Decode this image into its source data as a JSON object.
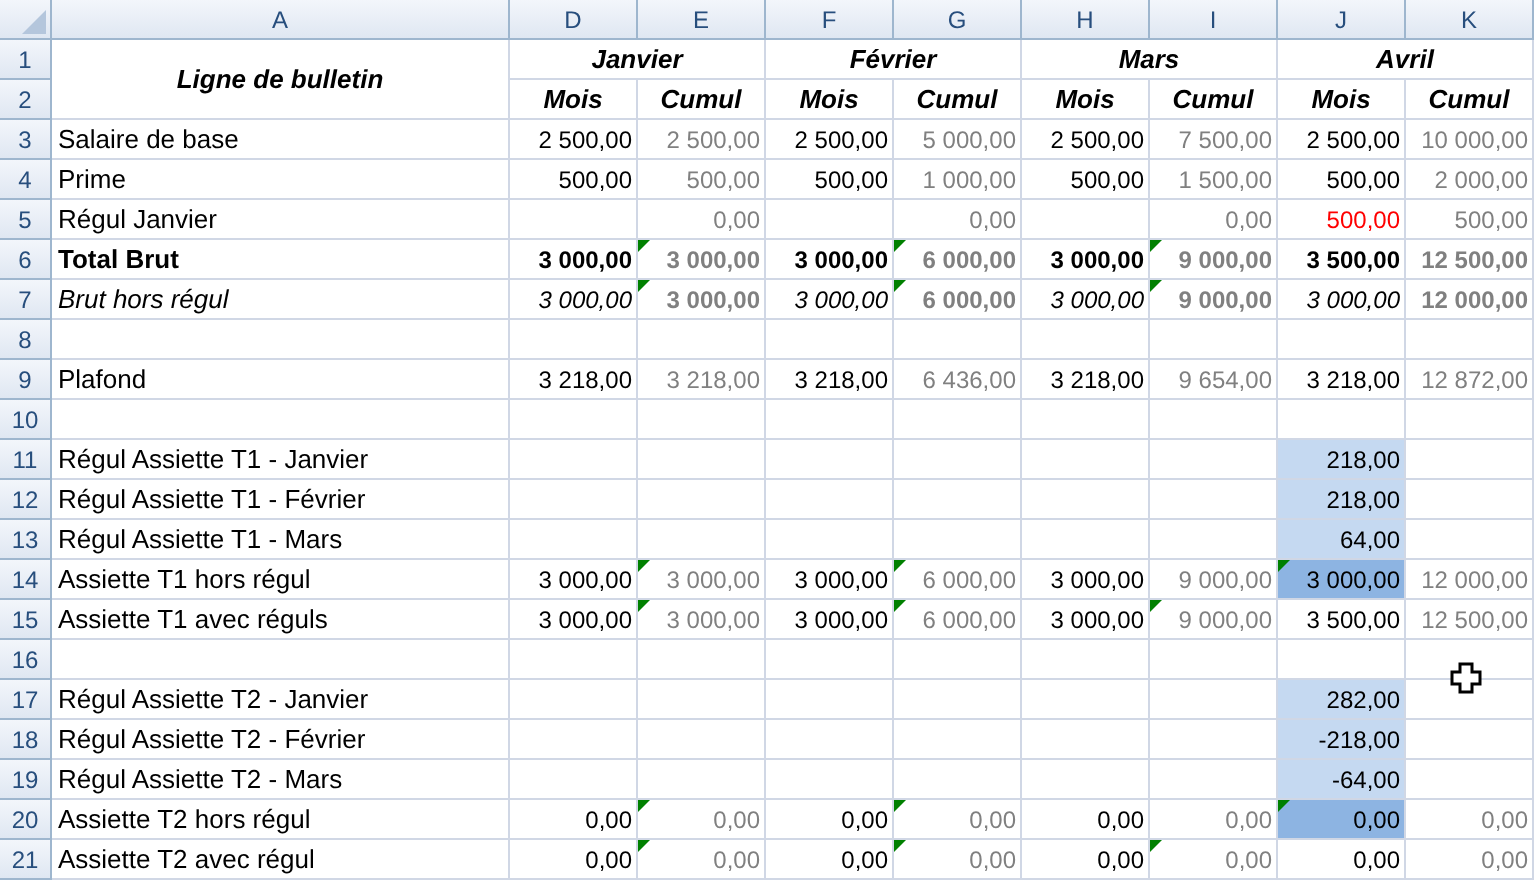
{
  "columns": [
    "A",
    "D",
    "E",
    "F",
    "G",
    "H",
    "I",
    "J",
    "K"
  ],
  "header": {
    "rows": [
      "1",
      "2"
    ],
    "title": "Ligne de bulletin",
    "months": [
      {
        "name": "Janvier",
        "sub": [
          "Mois",
          "Cumul"
        ]
      },
      {
        "name": "Février",
        "sub": [
          "Mois",
          "Cumul"
        ]
      },
      {
        "name": "Mars",
        "sub": [
          "Mois",
          "Cumul"
        ]
      },
      {
        "name": "Avril",
        "sub": [
          "Mois",
          "Cumul"
        ]
      }
    ]
  },
  "rows": [
    {
      "num": "3",
      "label": "Salaire de base",
      "kind": "line",
      "cells": [
        {
          "text": "2 500,00",
          "color": "#000000"
        },
        {
          "text": "2 500,00",
          "color": "#808080"
        },
        {
          "text": "2 500,00",
          "color": "#000000"
        },
        {
          "text": "5 000,00",
          "color": "#808080"
        },
        {
          "text": "2 500,00",
          "color": "#000000"
        },
        {
          "text": "7 500,00",
          "color": "#808080"
        },
        {
          "text": "2 500,00",
          "color": "#000000"
        },
        {
          "text": "10 000,00",
          "color": "#808080"
        }
      ]
    },
    {
      "num": "4",
      "label": "Prime",
      "kind": "line",
      "cells": [
        {
          "text": "500,00",
          "color": "#000000"
        },
        {
          "text": "500,00",
          "color": "#808080"
        },
        {
          "text": "500,00",
          "color": "#000000"
        },
        {
          "text": "1 000,00",
          "color": "#808080"
        },
        {
          "text": "500,00",
          "color": "#000000"
        },
        {
          "text": "1 500,00",
          "color": "#808080"
        },
        {
          "text": "500,00",
          "color": "#000000"
        },
        {
          "text": "2 000,00",
          "color": "#808080"
        }
      ]
    },
    {
      "num": "5",
      "label": "Régul Janvier",
      "kind": "line",
      "cells": [
        {},
        {
          "text": "0,00",
          "color": "#808080"
        },
        {},
        {
          "text": "0,00",
          "color": "#808080"
        },
        {},
        {
          "text": "0,00",
          "color": "#808080"
        },
        {
          "text": "500,00",
          "color": "#ff0000"
        },
        {
          "text": "500,00",
          "color": "#808080"
        }
      ]
    },
    {
      "num": "6",
      "label": "Total Brut",
      "kind": "total",
      "cells": [
        {
          "text": "3 000,00",
          "color": "#000000"
        },
        {
          "text": "3 000,00",
          "color": "#808080",
          "flag": true
        },
        {
          "text": "3 000,00",
          "color": "#000000"
        },
        {
          "text": "6 000,00",
          "color": "#808080",
          "flag": true
        },
        {
          "text": "3 000,00",
          "color": "#000000"
        },
        {
          "text": "9 000,00",
          "color": "#808080",
          "flag": true
        },
        {
          "text": "3 500,00",
          "color": "#000000"
        },
        {
          "text": "12 500,00",
          "color": "#808080"
        }
      ]
    },
    {
      "num": "7",
      "label": "Brut hors régul",
      "kind": "subtotal",
      "cells": [
        {
          "text": "3 000,00",
          "color": "#000000"
        },
        {
          "text": "3 000,00",
          "color": "#808080",
          "flag": true
        },
        {
          "text": "3 000,00",
          "color": "#000000"
        },
        {
          "text": "6 000,00",
          "color": "#808080",
          "flag": true
        },
        {
          "text": "3 000,00",
          "color": "#000000"
        },
        {
          "text": "9 000,00",
          "color": "#808080",
          "flag": true
        },
        {
          "text": "3 000,00",
          "color": "#000000"
        },
        {
          "text": "12 000,00",
          "color": "#808080"
        }
      ]
    },
    {
      "num": "8",
      "kind": "line",
      "cells": [
        {},
        {},
        {},
        {},
        {},
        {},
        {},
        {}
      ]
    },
    {
      "num": "9",
      "label": "Plafond",
      "kind": "line",
      "cells": [
        {
          "text": "3 218,00",
          "color": "#000000"
        },
        {
          "text": "3 218,00",
          "color": "#808080"
        },
        {
          "text": "3 218,00",
          "color": "#000000"
        },
        {
          "text": "6 436,00",
          "color": "#808080"
        },
        {
          "text": "3 218,00",
          "color": "#000000"
        },
        {
          "text": "9 654,00",
          "color": "#808080"
        },
        {
          "text": "3 218,00",
          "color": "#000000"
        },
        {
          "text": "12 872,00",
          "color": "#808080"
        }
      ]
    },
    {
      "num": "10",
      "kind": "line",
      "cells": [
        {},
        {},
        {},
        {},
        {},
        {},
        {},
        {}
      ]
    },
    {
      "num": "11",
      "label": "Régul Assiette T1 - Janvier",
      "kind": "line",
      "cells": [
        {},
        {},
        {},
        {},
        {},
        {},
        {
          "text": "218,00",
          "color": "#000000",
          "selected": true
        },
        {}
      ]
    },
    {
      "num": "12",
      "label": "Régul Assiette T1 - Février",
      "kind": "line",
      "cells": [
        {},
        {},
        {},
        {},
        {},
        {},
        {
          "text": "218,00",
          "color": "#000000",
          "selected": true
        },
        {}
      ]
    },
    {
      "num": "13",
      "label": "Régul Assiette T1 - Mars",
      "kind": "line",
      "cells": [
        {},
        {},
        {},
        {},
        {},
        {},
        {
          "text": "64,00",
          "color": "#000000",
          "selected": true
        },
        {}
      ]
    },
    {
      "num": "14",
      "label": "Assiette T1 hors régul",
      "kind": "line",
      "cells": [
        {
          "text": "3 000,00",
          "color": "#000000"
        },
        {
          "text": "3 000,00",
          "color": "#808080",
          "flag": true
        },
        {
          "text": "3 000,00",
          "color": "#000000"
        },
        {
          "text": "6 000,00",
          "color": "#808080",
          "flag": true
        },
        {
          "text": "3 000,00",
          "color": "#000000"
        },
        {
          "text": "9 000,00",
          "color": "#808080"
        },
        {
          "text": "3 000,00",
          "flag": true,
          "selected": true,
          "focused": true
        },
        {
          "text": "12 000,00",
          "color": "#808080"
        }
      ]
    },
    {
      "num": "15",
      "label": "Assiette T1 avec réguls",
      "kind": "line",
      "cells": [
        {
          "text": "3 000,00",
          "color": "#000000"
        },
        {
          "text": "3 000,00",
          "color": "#808080",
          "flag": true
        },
        {
          "text": "3 000,00",
          "color": "#000000"
        },
        {
          "text": "6 000,00",
          "color": "#808080",
          "flag": true
        },
        {
          "text": "3 000,00",
          "color": "#000000"
        },
        {
          "text": "9 000,00",
          "color": "#808080",
          "flag": true
        },
        {
          "text": "3 500,00",
          "color": "#000000"
        },
        {
          "text": "12 500,00",
          "color": "#808080"
        }
      ]
    },
    {
      "num": "16",
      "kind": "line",
      "cells": [
        {},
        {},
        {},
        {},
        {},
        {},
        {},
        {}
      ]
    },
    {
      "num": "17",
      "label": "Régul Assiette T2 - Janvier",
      "kind": "line",
      "cells": [
        {},
        {},
        {},
        {},
        {},
        {},
        {
          "text": "282,00",
          "color": "#000000",
          "selected": true
        },
        {}
      ]
    },
    {
      "num": "18",
      "label": "Régul Assiette T2 - Février",
      "kind": "line",
      "cells": [
        {},
        {},
        {},
        {},
        {},
        {},
        {
          "text": "-218,00",
          "color": "#000000",
          "selected": true
        },
        {}
      ]
    },
    {
      "num": "19",
      "label": "Régul Assiette T2 - Mars",
      "kind": "line",
      "cells": [
        {},
        {},
        {},
        {},
        {},
        {},
        {
          "text": "-64,00",
          "color": "#000000",
          "selected": true
        },
        {}
      ]
    },
    {
      "num": "20",
      "label": "Assiette T2 hors régul",
      "kind": "line",
      "cells": [
        {
          "text": "0,00",
          "color": "#000000"
        },
        {
          "text": "0,00",
          "color": "#808080",
          "flag": true
        },
        {
          "text": "0,00",
          "color": "#000000"
        },
        {
          "text": "0,00",
          "color": "#808080",
          "flag": true
        },
        {
          "text": "0,00",
          "color": "#000000"
        },
        {
          "text": "0,00",
          "color": "#808080"
        },
        {
          "text": "0,00",
          "flag": true,
          "selected": true,
          "focused": true
        },
        {
          "text": "0,00",
          "color": "#808080"
        }
      ]
    },
    {
      "num": "21",
      "label": "Assiette T2 avec régul",
      "kind": "line",
      "cells": [
        {
          "text": "0,00",
          "color": "#000000"
        },
        {
          "text": "0,00",
          "color": "#808080",
          "flag": true
        },
        {
          "text": "0,00",
          "color": "#000000"
        },
        {
          "text": "0,00",
          "color": "#808080",
          "flag": true
        },
        {
          "text": "0,00",
          "color": "#000000"
        },
        {
          "text": "0,00",
          "color": "#808080",
          "flag": true
        },
        {
          "text": "0,00",
          "color": "#000000"
        },
        {
          "text": "0,00",
          "color": "#808080"
        }
      ]
    }
  ]
}
